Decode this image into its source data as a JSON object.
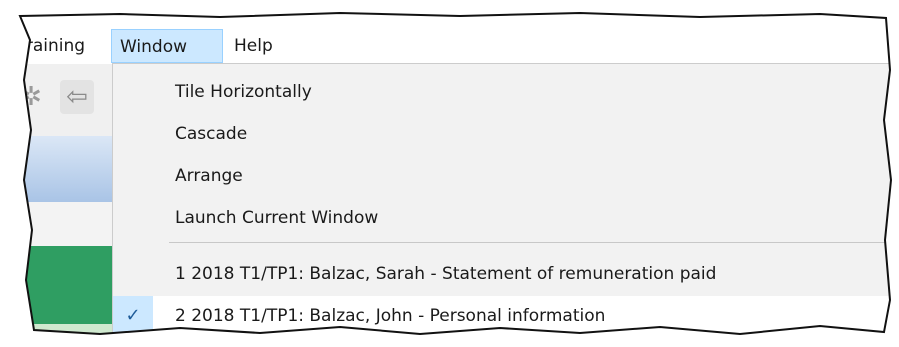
{
  "menubar": {
    "items": [
      {
        "label": "Training"
      },
      {
        "label": "Window"
      },
      {
        "label": "Help"
      }
    ]
  },
  "toolbar": {
    "icons": [
      "gear-icon",
      "back-arrow-icon"
    ]
  },
  "window_menu": {
    "items": [
      {
        "label": "Tile Horizontally"
      },
      {
        "label": "Cascade"
      },
      {
        "label": "Arrange"
      },
      {
        "label": "Launch Current Window"
      }
    ],
    "windows": [
      {
        "label": "1 2018 T1/TP1: Balzac, Sarah - Statement of remuneration paid",
        "checked": false
      },
      {
        "label": "2 2018 T1/TP1: Balzac, John - Personal information",
        "checked": true
      }
    ],
    "check_mark": "✓"
  },
  "colors": {
    "menu_highlight": "#cce8ff",
    "dropdown_bg": "#f2f2f2",
    "green_strip": "#2f9e62"
  }
}
